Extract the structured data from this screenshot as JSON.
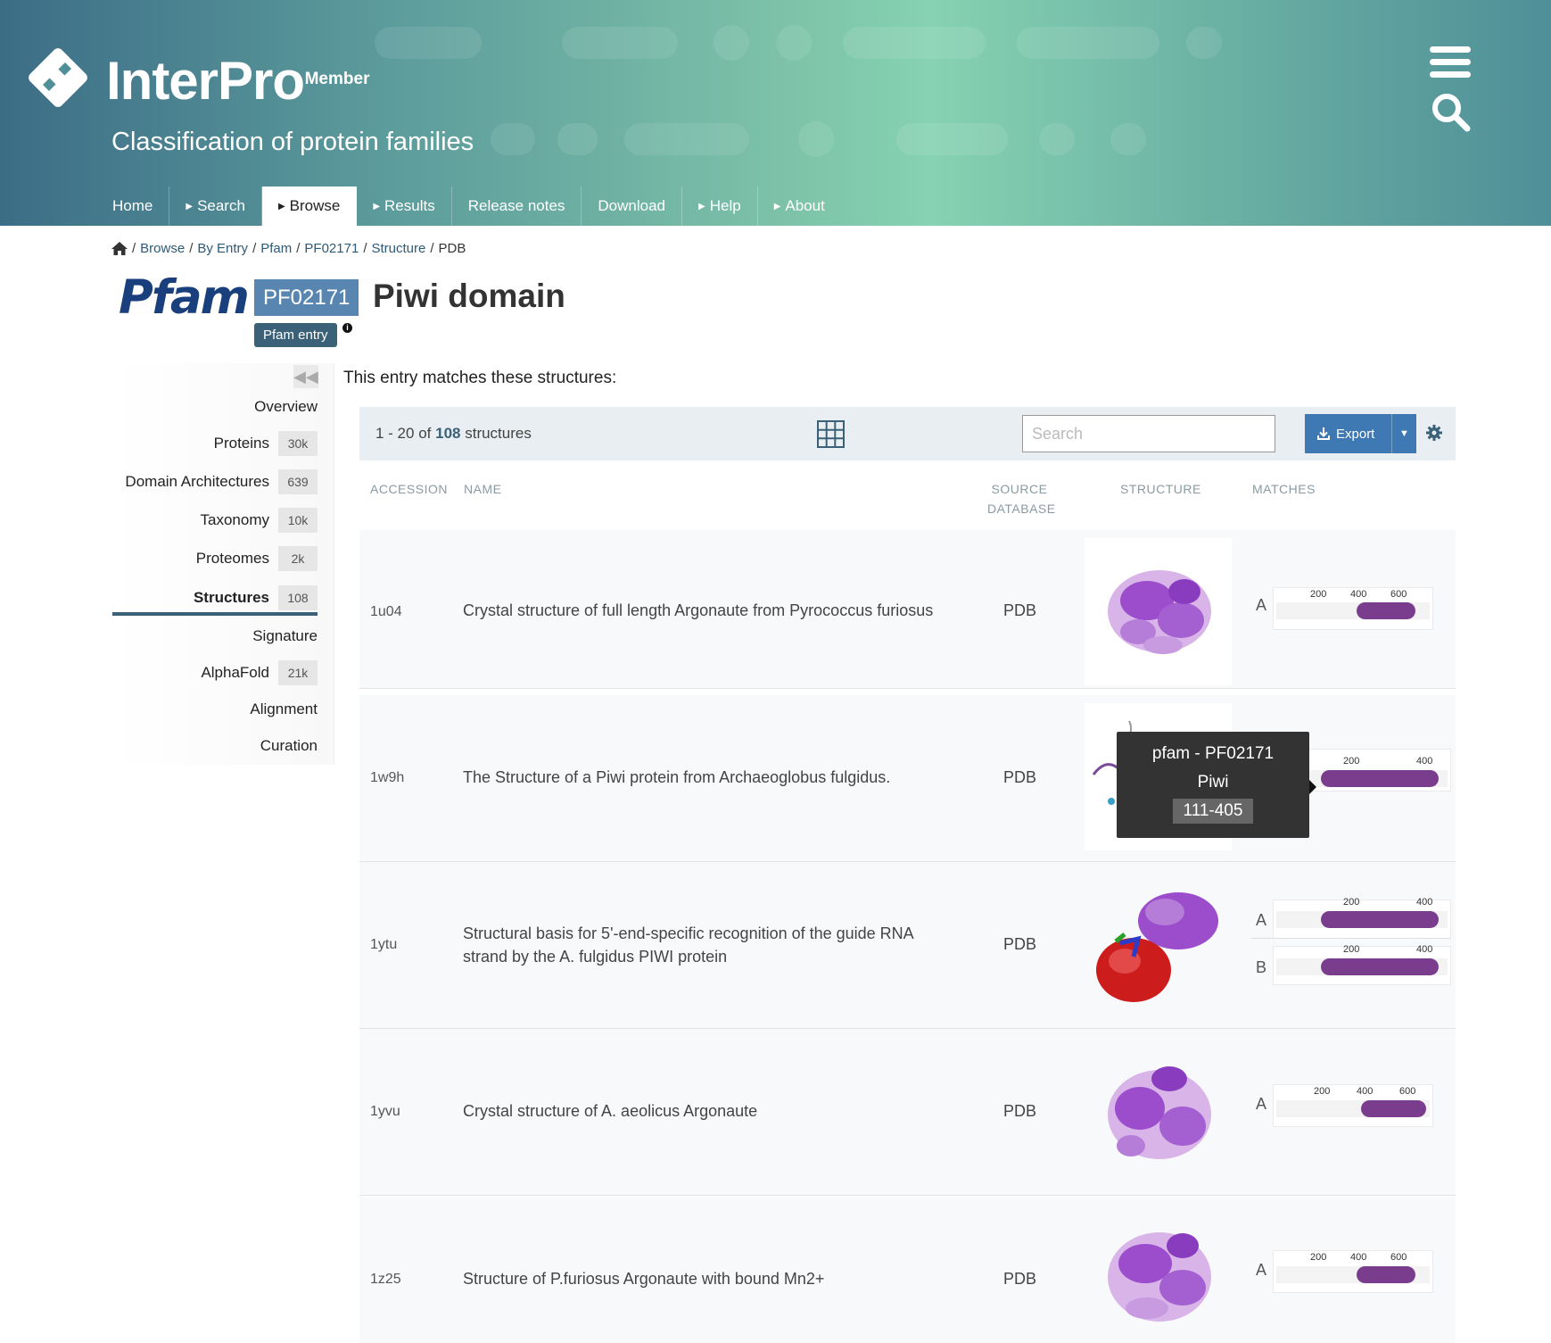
{
  "header": {
    "logo_text": "InterPro",
    "logo_sub": "- Member",
    "tagline": "Classification of protein families",
    "nav": [
      {
        "label": "Home",
        "arrow": false
      },
      {
        "label": "Search",
        "arrow": true
      },
      {
        "label": "Browse",
        "arrow": true,
        "active": true
      },
      {
        "label": "Results",
        "arrow": true
      },
      {
        "label": "Release notes",
        "arrow": false
      },
      {
        "label": "Download",
        "arrow": false
      },
      {
        "label": "Help",
        "arrow": true
      },
      {
        "label": "About",
        "arrow": true
      }
    ]
  },
  "breadcrumb": {
    "items": [
      "Browse",
      "By Entry",
      "Pfam",
      "PF02171",
      "Structure",
      "PDB"
    ],
    "sep": "/"
  },
  "entry": {
    "db_logo": "Pfam",
    "accession": "PF02171",
    "title": "Piwi domain",
    "type_badge": "Pfam entry",
    "info_glyph": "i"
  },
  "sidebar": {
    "collapse_glyph": "◀◀",
    "items": [
      {
        "label": "Overview",
        "count": ""
      },
      {
        "label": "Proteins",
        "count": "30k"
      },
      {
        "label": "Domain Architectures",
        "count": "639"
      },
      {
        "label": "Taxonomy",
        "count": "10k"
      },
      {
        "label": "Proteomes",
        "count": "2k"
      },
      {
        "label": "Structures",
        "count": "108",
        "active": true
      },
      {
        "label": "Signature",
        "count": ""
      },
      {
        "label": "AlphaFold",
        "count": "21k"
      },
      {
        "label": "Alignment",
        "count": ""
      },
      {
        "label": "Curation",
        "count": ""
      }
    ]
  },
  "main": {
    "intro": "This entry matches these structures:",
    "count_prefix": "1 - 20 of",
    "count_total": "108",
    "count_suffix": "structures",
    "search_placeholder": "Search",
    "export_label": "Export",
    "columns": {
      "accession": "ACCESSION",
      "name": "NAME",
      "source_line1": "SOURCE",
      "source_line2": "DATABASE",
      "structure": "STRUCTURE",
      "matches": "MATCHES"
    },
    "rows": [
      {
        "accession": "1u04",
        "name": "Crystal structure of full length Argonaute from Pyrococcus furiosus",
        "db": "PDB",
        "image": "structure-1u04",
        "chains": [
          {
            "chain": "A",
            "ticks": [
              "200",
              "400",
              "600"
            ],
            "length": 770,
            "start": 405,
            "end": 700
          }
        ]
      },
      {
        "accession": "1w9h",
        "name": "The Structure of a Piwi protein from Archaeoglobus fulgidus.",
        "db": "PDB",
        "image": "structure-1w9h",
        "chains": [
          {
            "chain": "",
            "ticks": [
              "200",
              "400"
            ],
            "length": 427,
            "start": 111,
            "end": 405
          }
        ]
      },
      {
        "accession": "1ytu",
        "name": "Structural basis for 5'-end-specific recognition of the guide RNA strand by the A. fulgidus PIWI protein",
        "db": "PDB",
        "image": "structure-1ytu",
        "chains": [
          {
            "chain": "A",
            "ticks": [
              "200",
              "400"
            ],
            "length": 427,
            "start": 111,
            "end": 405
          },
          {
            "chain": "B",
            "ticks": [
              "200",
              "400"
            ],
            "length": 427,
            "start": 111,
            "end": 405
          }
        ]
      },
      {
        "accession": "1yvu",
        "name": "Crystal structure of A. aeolicus Argonaute",
        "db": "PDB",
        "image": "structure-1yvu",
        "chains": [
          {
            "chain": "A",
            "ticks": [
              "200",
              "400",
              "600"
            ],
            "length": 706,
            "start": 390,
            "end": 690
          }
        ]
      },
      {
        "accession": "1z25",
        "name": "Structure of P.furiosus Argonaute with bound Mn2+",
        "db": "PDB",
        "image": "structure-1z25",
        "chains": [
          {
            "chain": "A",
            "ticks": [
              "200",
              "400",
              "600"
            ],
            "length": 770,
            "start": 405,
            "end": 700
          }
        ]
      }
    ],
    "tooltip": {
      "line1": "pfam - PF02171",
      "line2": "Piwi",
      "range": "111-405"
    }
  },
  "colors": {
    "match_bar": "#7a3d8e",
    "accent": "#3a6178",
    "export": "#3f79b3",
    "badge": "#5986b0"
  },
  "icons": [
    "interpro-logo-icon",
    "menu-icon",
    "search-icon",
    "home-icon",
    "grid-icon",
    "download-icon",
    "gear-icon",
    "info-icon"
  ]
}
